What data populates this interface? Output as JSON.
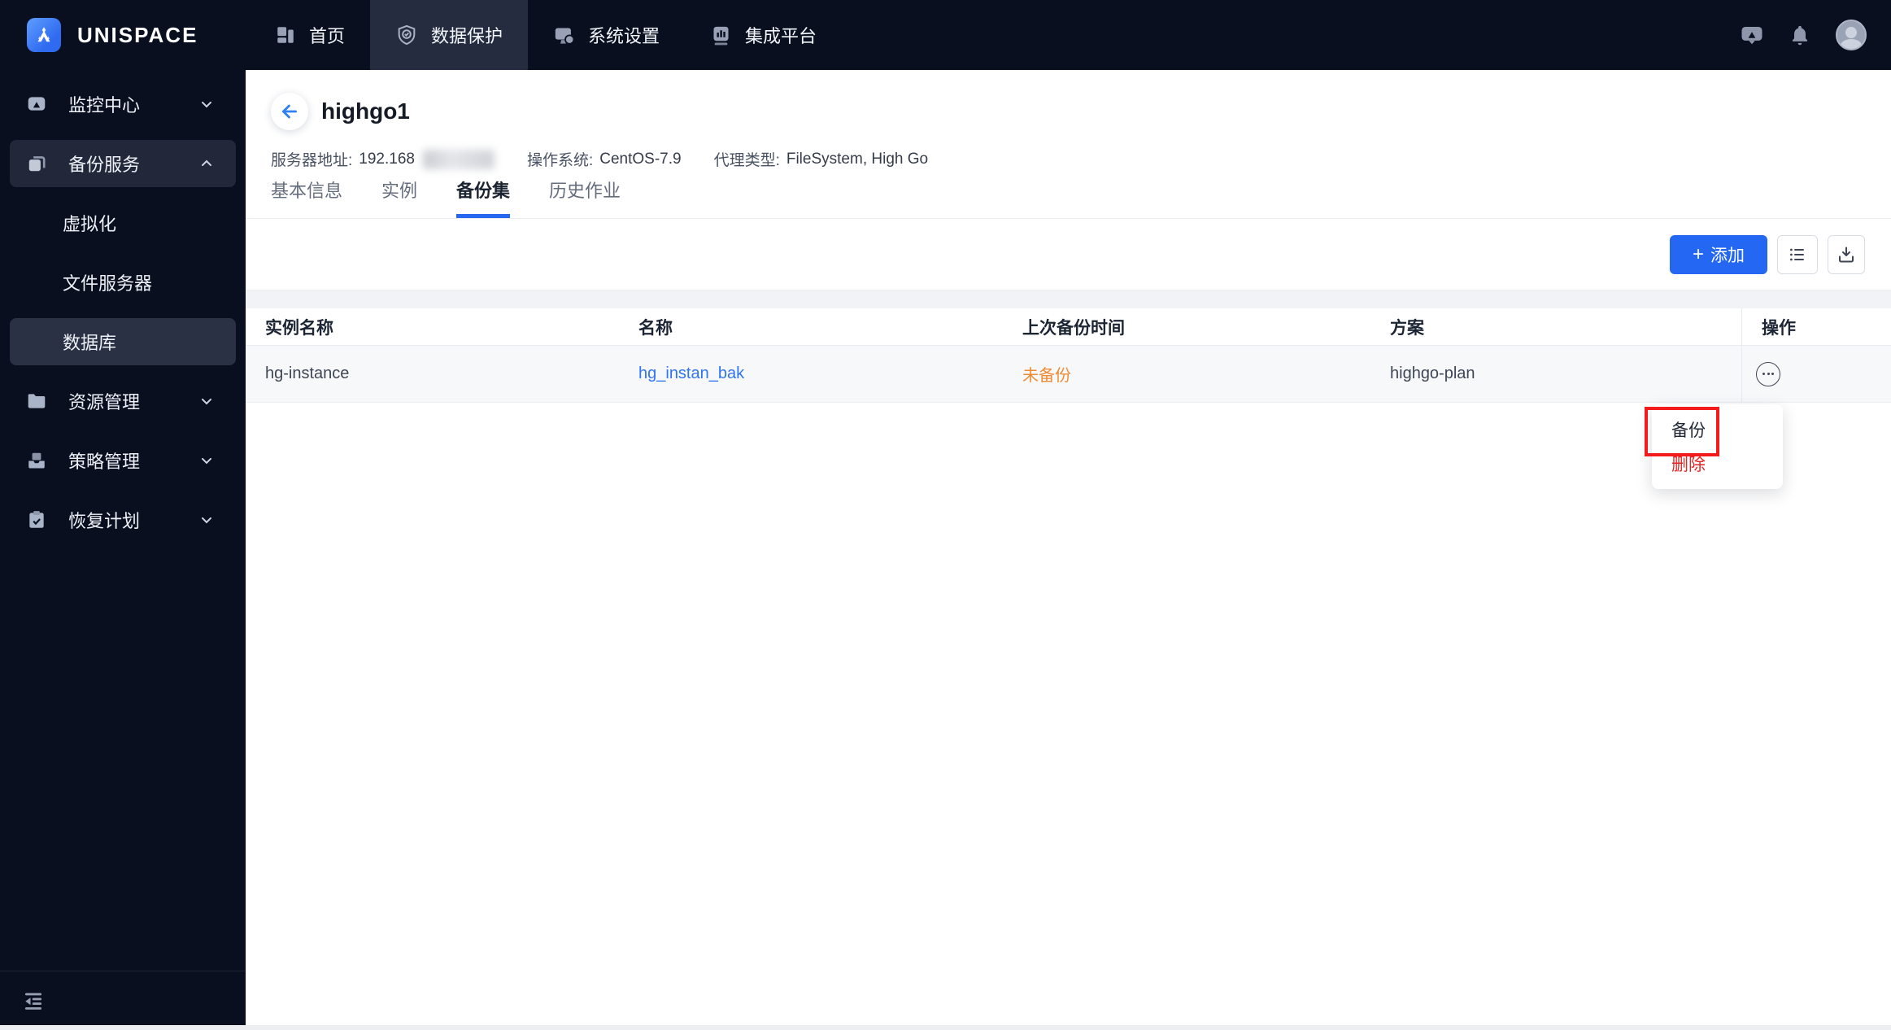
{
  "brand": {
    "name": "UNISPACE"
  },
  "topnav": {
    "items": [
      {
        "label": "首页",
        "icon": "dashboard-icon",
        "active": false
      },
      {
        "label": "数据保护",
        "icon": "shield-check-icon",
        "active": true
      },
      {
        "label": "系统设置",
        "icon": "system-settings-icon",
        "active": false
      },
      {
        "label": "集成平台",
        "icon": "integration-platform-icon",
        "active": false
      }
    ]
  },
  "topbar": {
    "right_icons": [
      "message-icon",
      "bell-icon",
      "avatar"
    ]
  },
  "sidebar": {
    "items": [
      {
        "label": "监控中心",
        "icon": "monitor-center-icon",
        "expanded": false
      },
      {
        "label": "备份服务",
        "icon": "backup-service-icon",
        "expanded": true,
        "active": true,
        "children": [
          {
            "label": "虚拟化",
            "active": false
          },
          {
            "label": "文件服务器",
            "active": false
          },
          {
            "label": "数据库",
            "active": true
          }
        ]
      },
      {
        "label": "资源管理",
        "icon": "folder-icon",
        "expanded": false
      },
      {
        "label": "策略管理",
        "icon": "policy-icon",
        "expanded": false
      },
      {
        "label": "恢复计划",
        "icon": "recovery-plan-icon",
        "expanded": false
      }
    ],
    "collapse_icon": "collapse-sidebar-icon"
  },
  "page": {
    "title": "highgo1",
    "meta": [
      {
        "label": "服务器地址:",
        "value": "192.168",
        "redacted": true
      },
      {
        "label": "操作系统:",
        "value": "CentOS-7.9"
      },
      {
        "label": "代理类型:",
        "value": "FileSystem, High Go"
      }
    ],
    "tabs": [
      {
        "label": "基本信息",
        "active": false
      },
      {
        "label": "实例",
        "active": false
      },
      {
        "label": "备份集",
        "active": true
      },
      {
        "label": "历史作业",
        "active": false
      }
    ]
  },
  "toolbar": {
    "add_label": "添加",
    "icons": [
      "list-view-icon",
      "download-icon"
    ]
  },
  "table": {
    "columns": [
      "实例名称",
      "名称",
      "上次备份时间",
      "方案",
      "操作"
    ],
    "rows": [
      {
        "instance": "hg-instance",
        "name": "hg_instan_bak",
        "last_backup": "未备份",
        "plan": "highgo-plan"
      }
    ]
  },
  "context_menu": {
    "items": [
      {
        "label": "备份",
        "danger": false,
        "annotated": true
      },
      {
        "label": "删除",
        "danger": true,
        "annotated": false
      }
    ]
  },
  "colors": {
    "accent": "#2569f2",
    "link": "#2f74f0",
    "warning": "#ee8c35",
    "danger": "#e22626",
    "annotation": "#f31b1b",
    "topbar_bg": "#0a0f20",
    "active_nav_bg": "#262c3f",
    "row_bg": "#f7f8fa"
  }
}
